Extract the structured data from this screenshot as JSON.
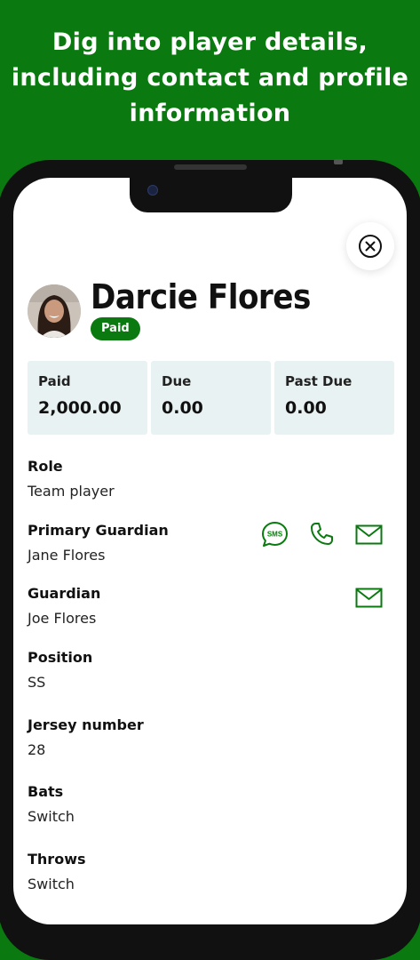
{
  "colors": {
    "accent": "#0a7a10",
    "card_bg": "#e9f2f2"
  },
  "headline": {
    "line1": "Dig into player details,",
    "line2": "including contact and profile",
    "line3": "information"
  },
  "player": {
    "name": "Darcie Flores",
    "status_badge": "Paid"
  },
  "summary": [
    {
      "label": "Paid",
      "value": "2,000.00"
    },
    {
      "label": "Due",
      "value": "0.00"
    },
    {
      "label": "Past Due",
      "value": "0.00"
    }
  ],
  "fields": {
    "role": {
      "label": "Role",
      "value": "Team player"
    },
    "primary_guardian": {
      "label": "Primary Guardian",
      "value": "Jane Flores"
    },
    "guardian": {
      "label": "Guardian",
      "value": "Joe Flores"
    },
    "position": {
      "label": "Position",
      "value": "SS"
    },
    "jersey": {
      "label": "Jersey number",
      "value": "28"
    },
    "bats": {
      "label": "Bats",
      "value": "Switch"
    },
    "throws": {
      "label": "Throws",
      "value": "Switch"
    }
  },
  "icons": {
    "sms": "sms-icon",
    "sms_text": "SMS",
    "phone": "phone-icon",
    "email": "email-icon",
    "close": "close-icon"
  }
}
